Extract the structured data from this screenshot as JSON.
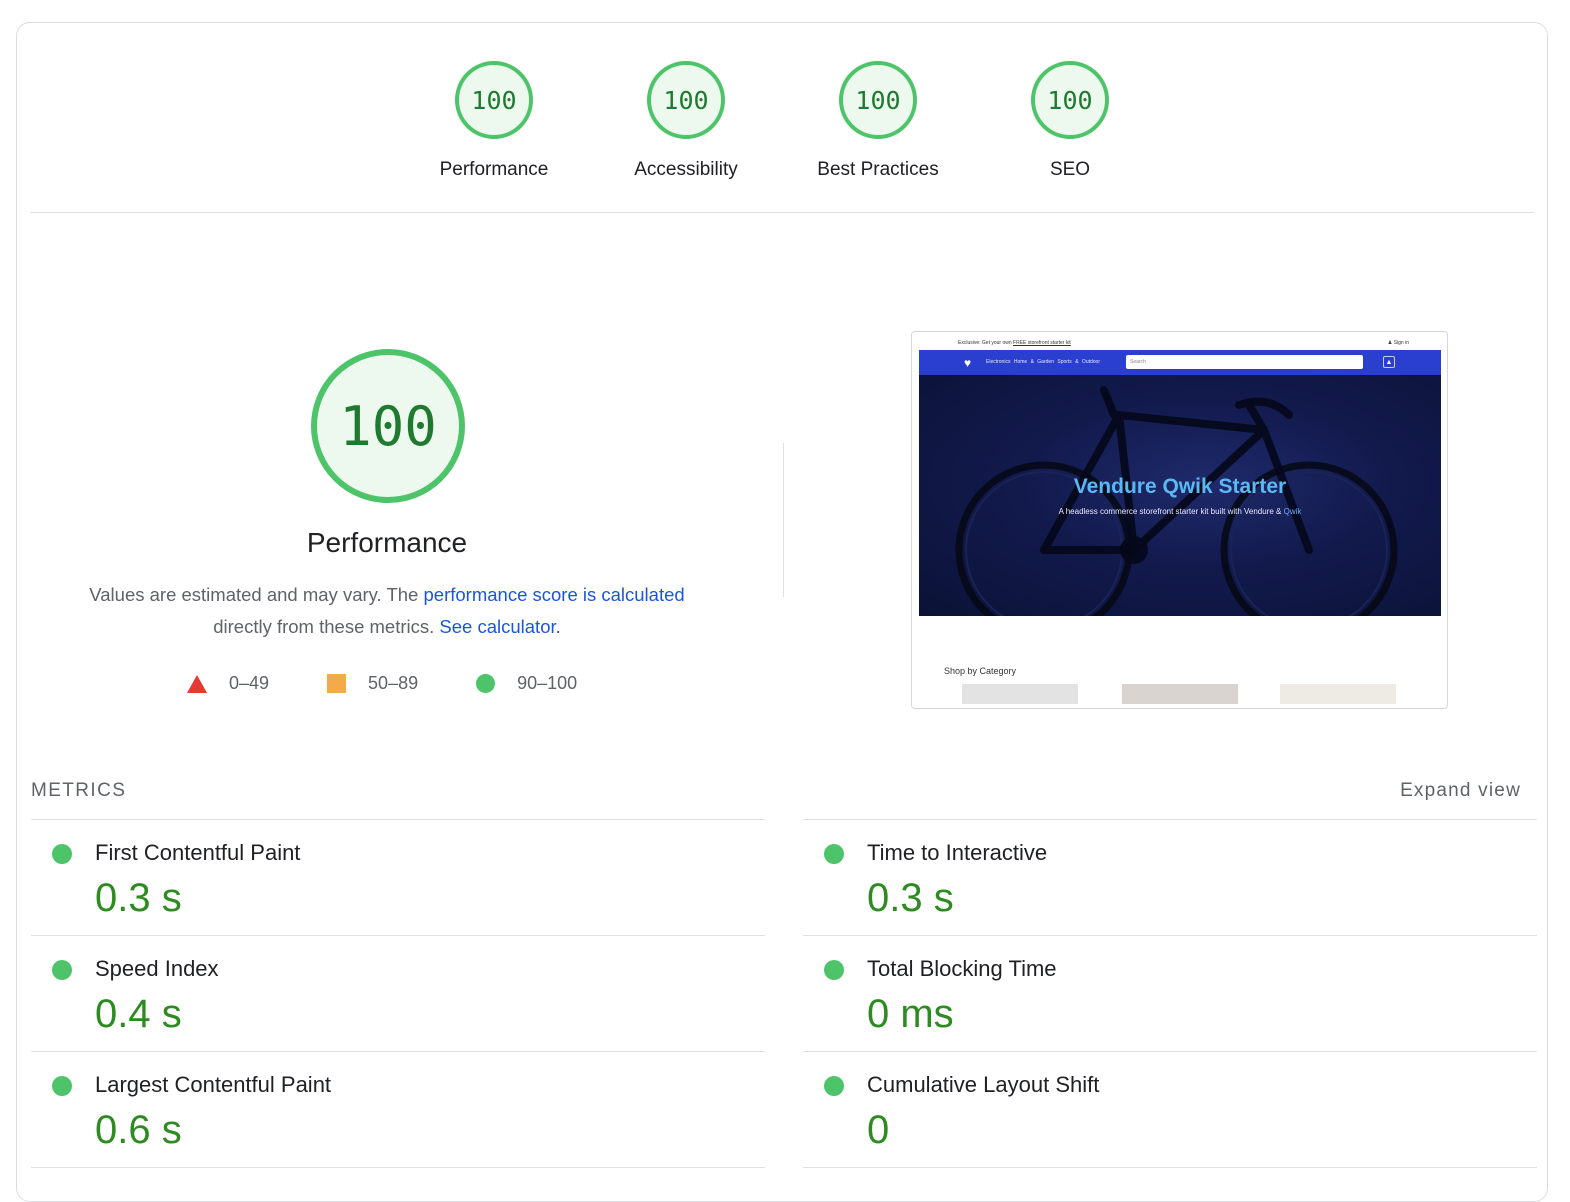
{
  "categories": [
    {
      "score": "100",
      "label": "Performance"
    },
    {
      "score": "100",
      "label": "Accessibility"
    },
    {
      "score": "100",
      "label": "Best Practices"
    },
    {
      "score": "100",
      "label": "SEO"
    }
  ],
  "performance": {
    "score": "100",
    "title": "Performance",
    "desc_prefix": "Values are estimated and may vary. The ",
    "desc_link": "performance score is calculated",
    "desc_middle": " directly from these metrics. ",
    "calc_link": "See calculator.",
    "legend": [
      {
        "icon": "triangle-icon",
        "range": "0–49",
        "color": "#e53935"
      },
      {
        "icon": "square-icon",
        "range": "50–89",
        "color": "#f4a94a"
      },
      {
        "icon": "circle-icon",
        "range": "90–100",
        "color": "#4ec46a"
      }
    ]
  },
  "screenshot": {
    "topbar_text": "Exclusive: Get your own ",
    "topbar_link": "FREE storefront starter kit",
    "signin": "Sign in",
    "nav_links": "Electronics  Home & Garden  Sports & Outdoor",
    "search_placeholder": "Search",
    "hero_title": "Vendure Qwik Starter",
    "hero_sub_prefix": "A headless commerce storefront starter kit built with Vendure & ",
    "hero_sub_link": "Qwik",
    "category_heading": "Shop by Category"
  },
  "metrics": {
    "heading": "METRICS",
    "expand": "Expand view",
    "left": [
      {
        "label": "First Contentful Paint",
        "value": "0.3 s"
      },
      {
        "label": "Speed Index",
        "value": "0.4 s"
      },
      {
        "label": "Largest Contentful Paint",
        "value": "0.6 s"
      }
    ],
    "right": [
      {
        "label": "Time to Interactive",
        "value": "0.3 s"
      },
      {
        "label": "Total Blocking Time",
        "value": "0 ms"
      },
      {
        "label": "Cumulative Layout Shift",
        "value": "0"
      }
    ]
  },
  "colors": {
    "pass": "#4ec46a",
    "pass_text": "#2e8b22",
    "link": "#1a56db"
  }
}
